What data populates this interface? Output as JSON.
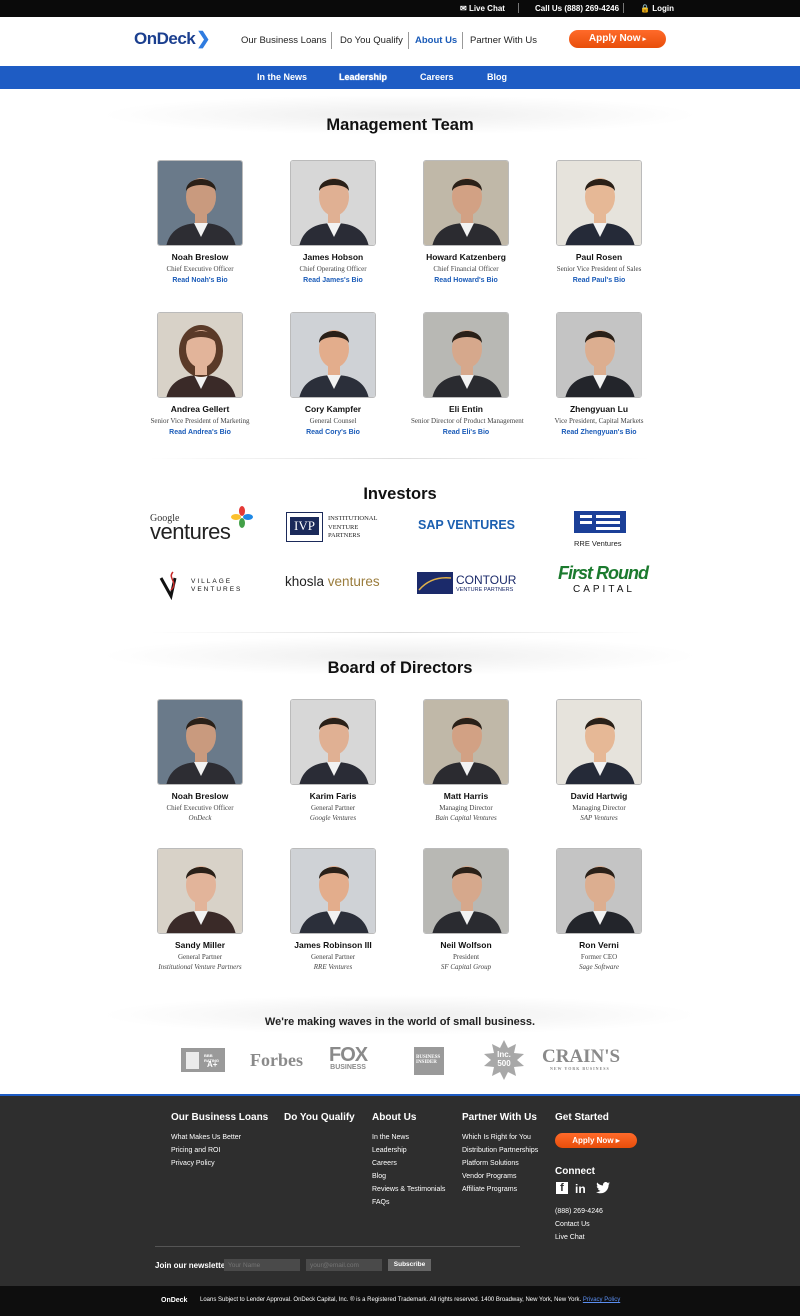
{
  "topbar": {
    "live_chat": "Live Chat",
    "call": "Call Us (888) 269-4246",
    "login": "Login"
  },
  "header": {
    "logo": "OnDeck",
    "nav": [
      "Our Business Loans",
      "Do You Qualify",
      "About Us",
      "Partner With Us"
    ],
    "apply": "Apply Now"
  },
  "subnav": [
    "In the News",
    "Leadership",
    "Careers",
    "Blog"
  ],
  "management": {
    "title": "Management Team",
    "people": [
      {
        "name": "Noah Breslow",
        "title": "Chief Executive Officer",
        "bio": "Read Noah's Bio"
      },
      {
        "name": "James Hobson",
        "title": "Chief Operating Officer",
        "bio": "Read James's Bio"
      },
      {
        "name": "Howard Katzenberg",
        "title": "Chief Financial Officer",
        "bio": "Read Howard's Bio"
      },
      {
        "name": "Paul Rosen",
        "title": "Senior Vice President of Sales",
        "bio": "Read Paul's Bio"
      },
      {
        "name": "Andrea Gellert",
        "title": "Senior Vice President of Marketing",
        "bio": "Read Andrea's Bio"
      },
      {
        "name": "Cory Kampfer",
        "title": "General Counsel",
        "bio": "Read Cory's Bio"
      },
      {
        "name": "Eli Entin",
        "title": "Senior Director of Product Management",
        "bio": "Read Eli's Bio"
      },
      {
        "name": "Zhengyuan Lu",
        "title": "Vice President, Capital Markets",
        "bio": "Read Zhengyuan's Bio"
      }
    ]
  },
  "investors": {
    "title": "Investors",
    "logos": {
      "google_small": "Google",
      "google_big": "ventures",
      "ivp_box": "IVP",
      "ivp_text": [
        "INSTITUTIONAL",
        "VENTURE",
        "PARTNERS"
      ],
      "sap": "SAP VENTURES",
      "rre": "RRE Ventures",
      "village": [
        "VILLAGE",
        "VENTURES"
      ],
      "khosla_a": "khosla",
      "khosla_b": "ventures",
      "contour": "CONTOUR",
      "contour_sub": "VENTURE PARTNERS",
      "firstround_a": "First Round",
      "firstround_b": "CAPITAL"
    }
  },
  "board": {
    "title": "Board of Directors",
    "people": [
      {
        "name": "Noah Breslow",
        "title": "Chief Executive Officer",
        "org": "OnDeck"
      },
      {
        "name": "Karim Faris",
        "title": "General Partner",
        "org": "Google Ventures"
      },
      {
        "name": "Matt Harris",
        "title": "Managing Director",
        "org": "Bain Capital Ventures"
      },
      {
        "name": "David Hartwig",
        "title": "Managing Director",
        "org": "SAP Ventures"
      },
      {
        "name": "Sandy Miller",
        "title": "General Partner",
        "org": "Institutional Venture Partners"
      },
      {
        "name": "James Robinson III",
        "title": "General Partner",
        "org": "RRE Ventures"
      },
      {
        "name": "Neil Wolfson",
        "title": "President",
        "org": "SF Capital Group"
      },
      {
        "name": "Ron Verni",
        "title": "Former CEO",
        "org": "Sage Software"
      }
    ]
  },
  "press": {
    "title": "We're making waves in the world of small business.",
    "bbb_a": "BBB RATING",
    "bbb_b": "A+",
    "forbes": "Forbes",
    "fox_a": "FOX",
    "fox_b": "BUSINESS",
    "bi_a": "BUSINESS",
    "bi_b": "INSIDER",
    "inc_a": "Inc.",
    "inc_b": "500",
    "crains": "CRAIN'S",
    "crains_sub": "NEW YORK BUSINESS"
  },
  "footer": {
    "col1": {
      "title": "Our Business Loans",
      "links": [
        "What Makes Us Better",
        "Pricing and ROI",
        "Privacy Policy"
      ]
    },
    "col2": {
      "title": "Do You Qualify"
    },
    "col3": {
      "title": "About Us",
      "links": [
        "In the News",
        "Leadership",
        "Careers",
        "Blog",
        "Reviews & Testimonials",
        "FAQs"
      ]
    },
    "col4": {
      "title": "Partner With Us",
      "links": [
        "Which Is Right for You",
        "Distribution Partnerships",
        "Platform Solutions",
        "Vendor Programs",
        "Affiliate Programs"
      ]
    },
    "col5": {
      "title": "Get Started",
      "apply": "Apply Now",
      "connect": "Connect",
      "social": [
        "f",
        "in",
        "t"
      ],
      "links": [
        "(888) 269-4246",
        "Contact Us",
        "Live Chat"
      ]
    },
    "newsletter": {
      "label": "Join our newsletter",
      "name_placeholder": "Your Name",
      "email_placeholder": "your@email.com",
      "button": "Subscribe"
    }
  },
  "bottom": {
    "logo": "OnDeck",
    "text": "Loans Subject to Lender Approval. OnDeck Capital, Inc. ® is a Registered Trademark. All rights reserved. 1400 Broadway, New York, New York.",
    "link": "Privacy Policy"
  },
  "colors": {
    "brand_blue": "#1e5cc4",
    "accent_orange": "#f05a14",
    "footer_bg": "#2e2e2e"
  }
}
